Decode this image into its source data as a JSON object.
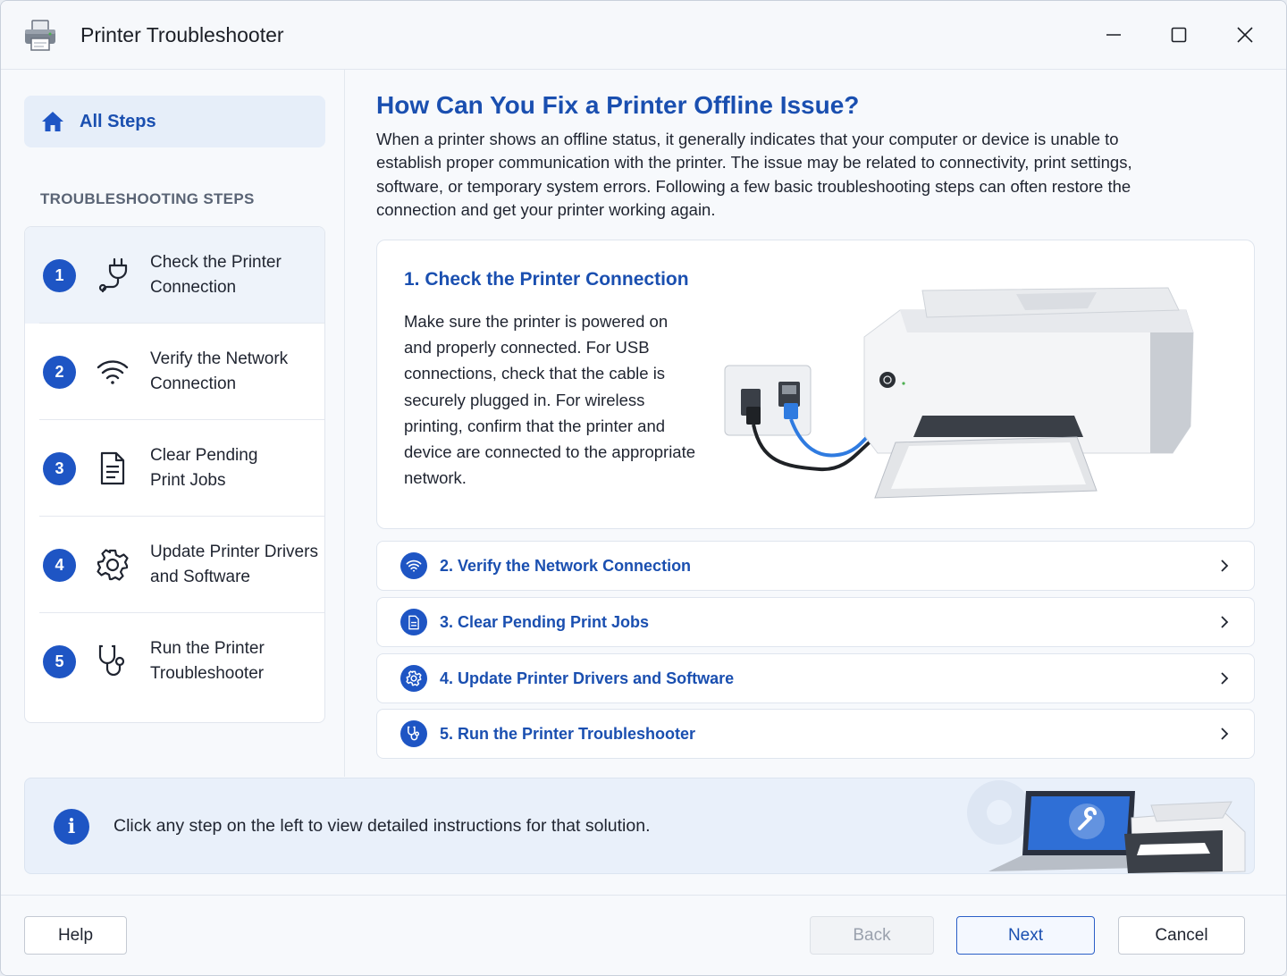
{
  "window": {
    "title": "Printer Troubleshooter",
    "icons": {
      "app": "printer-icon",
      "minimize": "minimize-icon",
      "maximize": "maximize-icon",
      "close": "close-icon"
    }
  },
  "colors": {
    "accent": "#1e55c4",
    "heading": "#1a4fb0",
    "active_row": "#eef3fa",
    "banner": "#e9f0fa"
  },
  "sidebar": {
    "all_steps": {
      "label": "All Steps",
      "icon": "home-icon"
    },
    "section_label": "TROUBLESHOOTING STEPS",
    "steps": [
      {
        "num": "1",
        "line1": "Check the Printer",
        "line2": "Connection",
        "icon": "plug-icon"
      },
      {
        "num": "2",
        "line1": "Verify the Network",
        "line2": "Connection",
        "icon": "wifi-icon"
      },
      {
        "num": "3",
        "line1": "Clear Pending",
        "line2": "Print Jobs",
        "icon": "document-icon"
      },
      {
        "num": "4",
        "line1": "Update Printer Drivers",
        "line2": "and Software",
        "icon": "gear-icon"
      },
      {
        "num": "5",
        "line1": "Run the Printer",
        "line2": "Troubleshooter",
        "icon": "stethoscope-icon"
      }
    ]
  },
  "main": {
    "title": "How Can You Fix a Printer Offline Issue?",
    "intro": "When a printer shows an offline status, it generally indicates that your computer or device is unable to establish proper communication with the printer. The issue may be related to connectivity, print settings, software, or temporary system errors. Following a few basic troubleshooting steps can often restore the connection and get your printer working again.",
    "detail": {
      "title": "1. Check the Printer Connection",
      "body": "Make sure the printer is powered on and properly connected. For USB connections, check that the cable is securely plugged in. For wireless printing, confirm that the printer and device are connected to the appropriate network."
    },
    "accordion": [
      {
        "label": "2. Verify the Network Connection",
        "icon": "wifi-icon"
      },
      {
        "label": "3. Clear Pending Print Jobs",
        "icon": "document-icon"
      },
      {
        "label": "4. Update Printer Drivers and Software",
        "icon": "gear-icon"
      },
      {
        "label": "5. Run the Printer Troubleshooter",
        "icon": "stethoscope-icon"
      }
    ]
  },
  "info": {
    "text": "Click any step on the left to view detailed instructions for that solution.",
    "icon": "info-icon"
  },
  "footer": {
    "help": "Help",
    "back": "Back",
    "next": "Next",
    "cancel": "Cancel"
  }
}
